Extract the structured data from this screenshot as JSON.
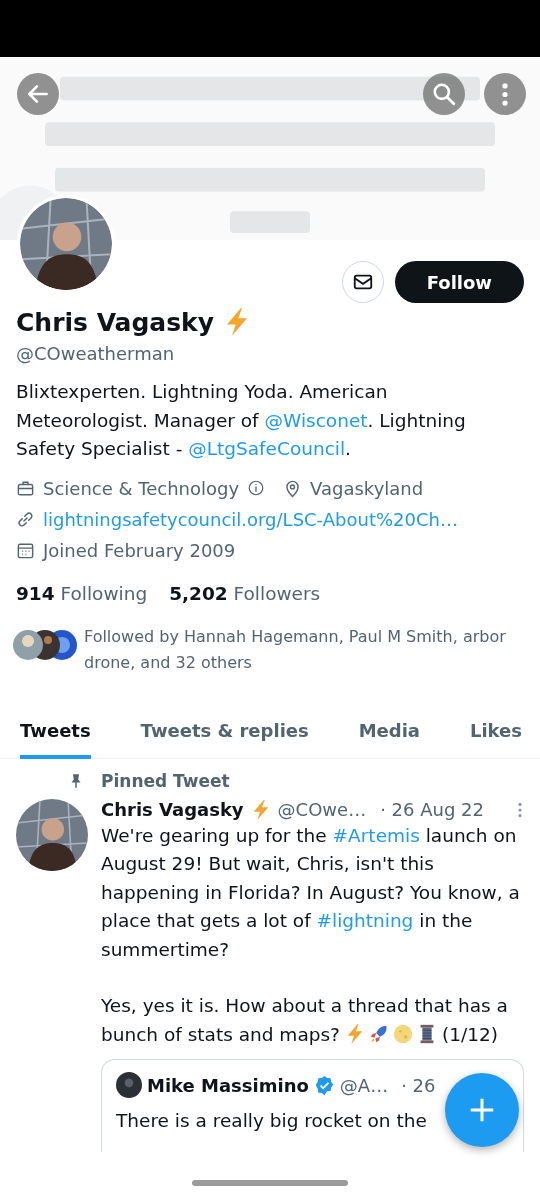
{
  "profile": {
    "name": "Chris Vagasky",
    "handle": "@COweatherman",
    "follow_button": "Follow",
    "bio": [
      {
        "kind": "text",
        "text": "Blixtexperten. Lightning Yoda. American Meteorologist. Manager of "
      },
      {
        "kind": "link",
        "text": "@Wisconet"
      },
      {
        "kind": "text",
        "text": ". Lightning Safety Specialist - "
      },
      {
        "kind": "link",
        "text": "@LtgSafeCouncil"
      },
      {
        "kind": "text",
        "text": "."
      }
    ],
    "meta": [
      {
        "kind": "category",
        "text": "Science & Technology"
      },
      {
        "kind": "location",
        "text": "Vagaskyland"
      },
      {
        "kind": "website",
        "text": "lightningsafetycouncil.org/LSC-About%20Ch…"
      },
      {
        "kind": "joined",
        "text": "Joined February 2009"
      }
    ],
    "stats": [
      {
        "count": "914",
        "label": "Following"
      },
      {
        "count": "5,202",
        "label": "Followers"
      }
    ],
    "followed_by": "Followed by Hannah Hagemann, Paul M Smith, arbor drone, and 32 others"
  },
  "tabs": [
    {
      "label": "Tweets",
      "selected": true
    },
    {
      "label": "Tweets & replies",
      "selected": false
    },
    {
      "label": "Media",
      "selected": false
    },
    {
      "label": "Likes",
      "selected": false
    }
  ],
  "pinned_label": "Pinned Tweet",
  "tweet": {
    "name": "Chris Vagasky",
    "handle": "@COwe…",
    "date": "· 26 Aug 22",
    "paragraph_1": [
      {
        "kind": "text",
        "text": "We're gearing up for the "
      },
      {
        "kind": "link",
        "text": "#Artemis"
      },
      {
        "kind": "text",
        "text": " launch on August 29! But wait, Chris, isn't this happening in Florida? In August? You know, a place that gets a lot of "
      },
      {
        "kind": "link",
        "text": "#lightning"
      },
      {
        "kind": "text",
        "text": " in the summertime?"
      }
    ],
    "paragraph_2": "Yes, yes it is. How about a thread that has a bunch of stats and maps?",
    "thread_count": "(1/12)",
    "quote": {
      "name": "Mike Massimino",
      "verified": true,
      "handle": "@A…",
      "date": "· 26",
      "text": "There is a really big rocket on the"
    }
  }
}
